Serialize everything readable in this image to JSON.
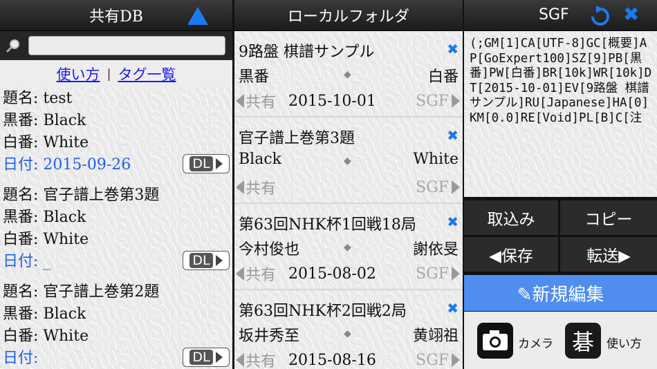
{
  "shared_db": {
    "title": "共有DB",
    "links": {
      "howto": "使い方",
      "separator": "|",
      "tags": "タグ一覧"
    },
    "entries": [
      {
        "title": "題名: test",
        "black": "黒番: Black",
        "white": "白番: White",
        "date": "日付: 2015-09-26",
        "dl": "DL"
      },
      {
        "title": "題名: 官子譜上巻第3題",
        "black": "黒番: Black",
        "white": "白番: White",
        "date": "日付: _",
        "dl": "DL"
      },
      {
        "title": "題名: 官子譜上巻第2題",
        "black": "黒番: Black",
        "white": "白番: White",
        "date": "日付:",
        "dl": "DL"
      }
    ]
  },
  "local_folder": {
    "title": "ローカルフォルダ",
    "items": [
      {
        "title": "9路盤 棋譜サンプル",
        "black": "黒番",
        "white": "白番",
        "share": "共有",
        "date": "2015-10-01",
        "sgf": "SGF"
      },
      {
        "title": "官子譜上巻第3題",
        "black": "Black",
        "white": "White",
        "share": "共有",
        "date": "",
        "sgf": "SGF"
      },
      {
        "title": "第63回NHK杯1回戦18局",
        "black": "今村俊也",
        "white": "謝依旻",
        "share": "共有",
        "date": "2015-08-02",
        "sgf": "SGF"
      },
      {
        "title": "第63回NHK杯2回戦2局",
        "black": "坂井秀至",
        "white": "黄翊祖",
        "share": "共有",
        "date": "2015-08-16",
        "sgf": "SGF"
      }
    ]
  },
  "sgf_panel": {
    "title": "SGF",
    "text": "(;GM[1]CA[UTF-8]GC[概要]AP[GoExpert100]SZ[9]PB[黒番]PW[白番]BR[10k]WR[10k]DT[2015-10-01]EV[9路盤 棋譜サンプル]RU[Japanese]HA[0]KM[0.0]RE[Void]PL[B]C[注",
    "buttons": {
      "import": "取込み",
      "copy": "コピー",
      "save": "◀保存",
      "transfer": "転送▶"
    },
    "new_edit": "✎新規編集",
    "camera_label": "カメラ",
    "go_icon_char": "碁",
    "howto_label": "使い方"
  },
  "colors": {
    "accent_blue": "#1a7af0",
    "new_edit_bg": "#4f8ef0",
    "date_blue": "#1f5fe8"
  }
}
